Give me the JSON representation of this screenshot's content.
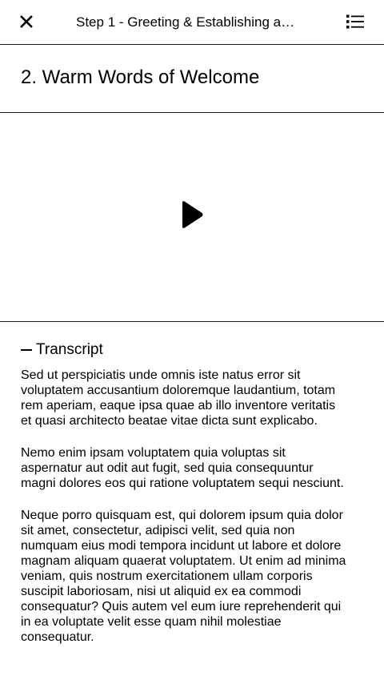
{
  "topbar": {
    "close_icon": "close-icon",
    "title": "Step 1 - Greeting & Establishing a…",
    "list_icon": "list-icon"
  },
  "lesson": {
    "title": "2. Warm Words of Welcome"
  },
  "video": {
    "play_icon": "play-icon"
  },
  "transcript": {
    "label": "Transcript",
    "toggle_icon": "minus-icon",
    "paragraphs": [
      "Sed ut perspiciatis unde omnis iste natus error sit voluptatem accusantium doloremque laudantium, totam rem aperiam, eaque ipsa quae ab illo inventore veritatis et quasi architecto beatae vitae dicta sunt explicabo.",
      "Nemo enim ipsam voluptatem quia voluptas sit aspernatur aut odit aut fugit, sed quia consequuntur magni dolores eos qui ratione voluptatem sequi nesciunt.",
      "Neque porro quisquam est, qui dolorem ipsum quia dolor sit amet, consectetur, adipisci velit, sed quia non numquam eius modi tempora incidunt ut labore et dolore magnam aliquam quaerat voluptatem. Ut enim ad minima veniam, quis nostrum exercitationem ullam corporis suscipit laboriosam, nisi ut aliquid ex ea commodi consequatur? Quis autem vel eum iure reprehenderit qui in ea voluptate velit esse quam nihil molestiae consequatur."
    ]
  }
}
